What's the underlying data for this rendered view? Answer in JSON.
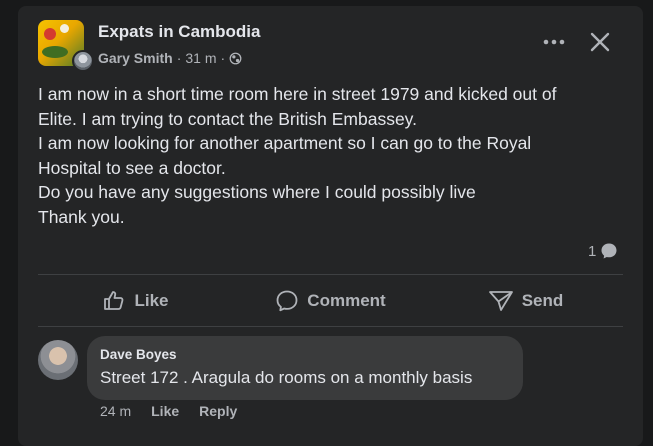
{
  "post": {
    "group_name": "Expats in Cambodia",
    "author": "Gary Smith",
    "separator": "·",
    "time": "31 m",
    "text_lines": [
      "I am now in a short time room here in street 1979 and kicked out of",
      "Elite. I am trying to contact the British Embassey.",
      "I am now looking for another apartment so I can go to the Royal",
      "Hospital to see a doctor.",
      "Do you have any suggestions where I could possibly live",
      "Thank you."
    ],
    "comment_count": "1"
  },
  "actions": {
    "like": "Like",
    "comment": "Comment",
    "send": "Send"
  },
  "comment": {
    "name": "Dave Boyes",
    "text": "Street 172 . Aragula do rooms on a monthly basis",
    "time": "24 m",
    "like": "Like",
    "reply": "Reply"
  },
  "icons": {
    "privacy": "globe-icon",
    "more": "more-options-icon",
    "close": "close-icon",
    "comment_count": "comment-bubble-icon",
    "like": "thumbs-up-icon",
    "comment": "comment-icon",
    "send": "send-icon"
  },
  "colors": {
    "background": "#18191a",
    "card": "#242526",
    "bubble": "#3a3b3c",
    "primary_text": "#e4e6eb",
    "secondary_text": "#b0b3b8"
  }
}
